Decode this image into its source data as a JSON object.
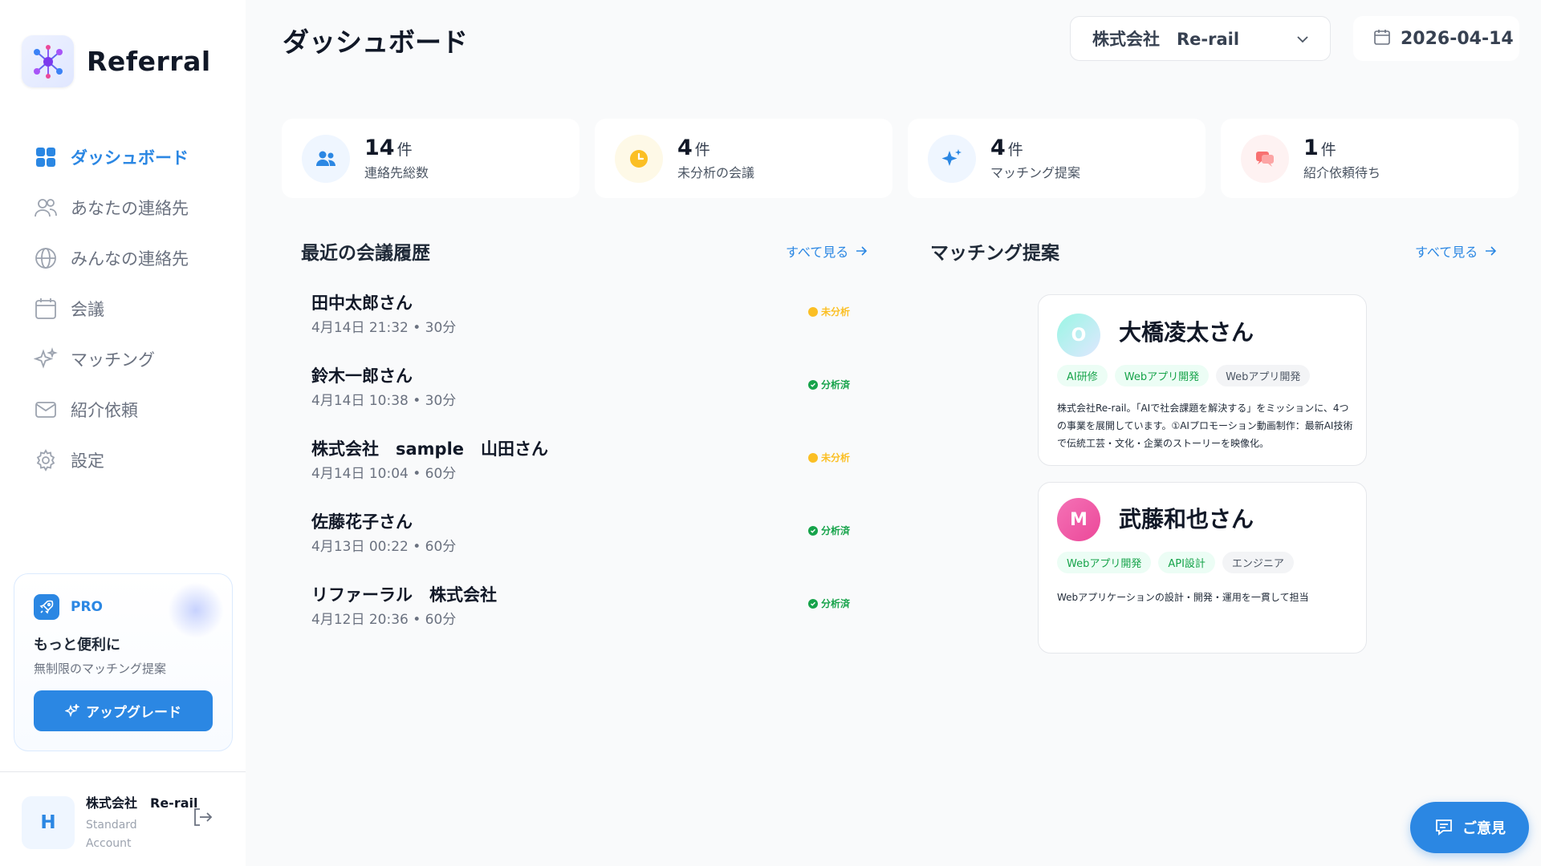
{
  "app": {
    "brand": "Referral",
    "page_title": "ダッシュボード"
  },
  "header": {
    "company": "株式会社　Re-rail",
    "date": "2026-04-14"
  },
  "sidebar": {
    "items": [
      {
        "label": "ダッシュボード",
        "icon": "grid-icon",
        "active": true
      },
      {
        "label": "あなたの連絡先",
        "icon": "users-icon",
        "active": false
      },
      {
        "label": "みんなの連絡先",
        "icon": "globe-icon",
        "active": false
      },
      {
        "label": "会議",
        "icon": "calendar-icon",
        "active": false
      },
      {
        "label": "マッチング",
        "icon": "sparkles-icon",
        "active": false
      },
      {
        "label": "紹介依頼",
        "icon": "mail-icon",
        "active": false
      },
      {
        "label": "設定",
        "icon": "gear-icon",
        "active": false
      }
    ],
    "pro": {
      "badge": "PRO",
      "title": "もっと便利に",
      "subtitle": "無制限のマッチング提案",
      "button": "アップグレード"
    },
    "account": {
      "initial": "H",
      "name": "株式会社　Re-rail",
      "plan": "Standard Account"
    }
  },
  "stats": [
    {
      "value": "14",
      "unit": "件",
      "label": "連絡先総数",
      "icon": "users-icon",
      "color": "#2b87e3",
      "bg": "#eff6ff"
    },
    {
      "value": "4",
      "unit": "件",
      "label": "未分析の会議",
      "icon": "clock-icon",
      "color": "#fbbf24",
      "bg": "#fef9e7"
    },
    {
      "value": "4",
      "unit": "件",
      "label": "マッチング提案",
      "icon": "sparkles-icon",
      "color": "#2b87e3",
      "bg": "#eff6ff"
    },
    {
      "value": "1",
      "unit": "件",
      "label": "紹介依頼待ち",
      "icon": "chat-icon",
      "color": "#f87171",
      "bg": "#fef2f2"
    }
  ],
  "meetings": {
    "title": "最近の会議履歴",
    "see_all": "すべて見る",
    "items": [
      {
        "name": "田中太郎さん",
        "meta": "4月14日 21:32 • 30分",
        "status": "未分析",
        "state": "pending"
      },
      {
        "name": "鈴木一郎さん",
        "meta": "4月14日 10:38 • 30分",
        "status": "分析済",
        "state": "done"
      },
      {
        "name": "株式会社　sample　山田さん",
        "meta": "4月14日 10:04 • 60分",
        "status": "未分析",
        "state": "pending"
      },
      {
        "name": "佐藤花子さん",
        "meta": "4月13日 00:22 • 60分",
        "status": "分析済",
        "state": "done"
      },
      {
        "name": "リファーラル　株式会社",
        "meta": "4月12日 20:36 • 60分",
        "status": "分析済",
        "state": "done"
      }
    ]
  },
  "matching": {
    "title": "マッチング提案",
    "see_all": "すべて見る",
    "cards": [
      {
        "initial": "O",
        "name": "大橋凌太さん",
        "tags": [
          {
            "label": "AI研修",
            "style": "green"
          },
          {
            "label": "Webアプリ開発",
            "style": "green"
          },
          {
            "label": "Webアプリ開発",
            "style": "gray"
          }
        ],
        "description": "株式会社Re-rail。「AIで社会課題を解決する」をミッションに、4つの事業を展開しています。①AIプロモーション動画制作：最新AI技術で伝統工芸・文化・企業のストーリーを映像化。"
      },
      {
        "initial": "M",
        "name": "武藤和也さん",
        "tags": [
          {
            "label": "Webアプリ開発",
            "style": "green"
          },
          {
            "label": "API設計",
            "style": "green"
          },
          {
            "label": "エンジニア",
            "style": "gray"
          }
        ],
        "description": "Webアプリケーションの設計・開発・運用を一貫して担当"
      }
    ]
  },
  "feedback": {
    "label": "ご意見"
  },
  "colors": {
    "accent": "#2b87e3",
    "pending": "#fbbf24",
    "done": "#16a34a"
  }
}
